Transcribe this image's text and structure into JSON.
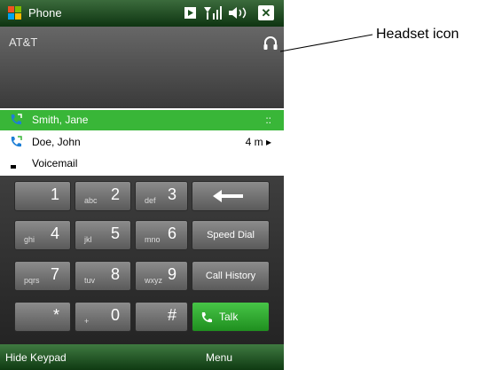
{
  "window": {
    "title": "Phone",
    "close_label": "✕"
  },
  "status": {
    "carrier": "AT&T"
  },
  "calls": [
    {
      "name": "Smith, Jane",
      "time": "::"
    },
    {
      "name": "Doe, John",
      "time": "4 m ▸"
    },
    {
      "name": "Voicemail",
      "time": ""
    }
  ],
  "keypad": {
    "row1": [
      {
        "sub": "",
        "digit": "1"
      },
      {
        "sub": "abc",
        "digit": "2"
      },
      {
        "sub": "def",
        "digit": "3"
      }
    ],
    "row2": [
      {
        "sub": "ghi",
        "digit": "4"
      },
      {
        "sub": "jkl",
        "digit": "5"
      },
      {
        "sub": "mno",
        "digit": "6"
      }
    ],
    "row3": [
      {
        "sub": "pqrs",
        "digit": "7"
      },
      {
        "sub": "tuv",
        "digit": "8"
      },
      {
        "sub": "wxyz",
        "digit": "9"
      }
    ],
    "row4": [
      {
        "sub": "",
        "digit": "*"
      },
      {
        "sub": "+",
        "digit": "0"
      },
      {
        "sub": "",
        "digit": "#"
      }
    ],
    "speed_dial": "Speed Dial",
    "call_history": "Call History",
    "talk": "Talk"
  },
  "softkeys": {
    "left": "Hide Keypad",
    "right": "Menu"
  },
  "annotation": {
    "label": "Headset icon"
  },
  "colors": {
    "accent_green": "#39b638",
    "titlebar_green": "#1a4f1d"
  },
  "icons": {
    "start": "windows-flag-icon",
    "headset": "headset-icon",
    "call": "phone-call-icon",
    "voicemail": "voicemail-icon",
    "backspace": "left-arrow-icon"
  }
}
